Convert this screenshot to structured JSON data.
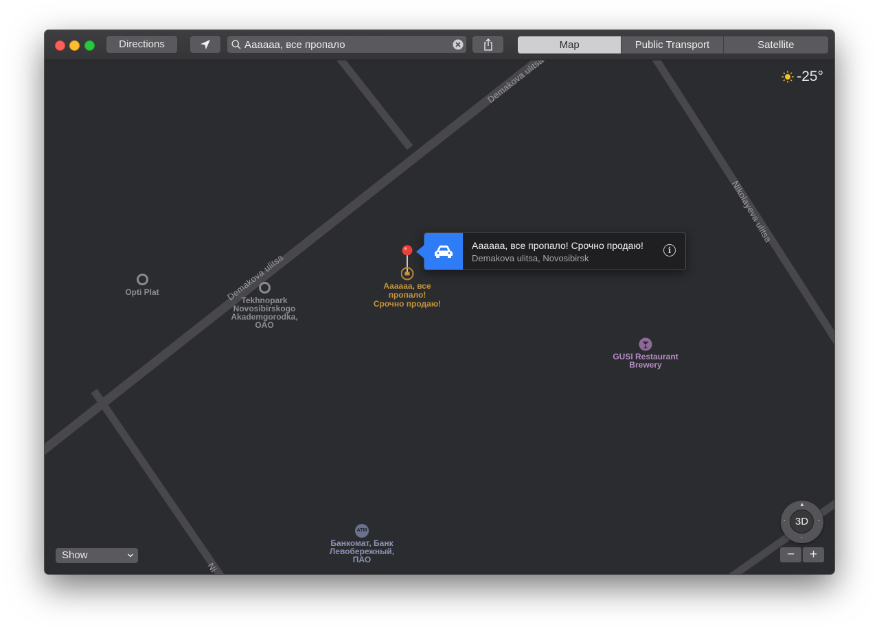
{
  "toolbar": {
    "directions_label": "Directions",
    "search_value": "Аааааа, все пропало",
    "map_types": [
      {
        "label": "Map",
        "active": true
      },
      {
        "label": "Public Transport",
        "active": false
      },
      {
        "label": "Satellite",
        "active": false
      }
    ],
    "icons": [
      "location-arrow-icon",
      "search-icon",
      "clear-search-icon",
      "share-icon"
    ]
  },
  "weather": {
    "temperature": "-25°",
    "icon": "sun-icon"
  },
  "map": {
    "roads": {
      "demakova_upper": "Demakova ulitsa",
      "demakova_lower": "Demakova ulitsa",
      "nikolayeva": "Nikolayeva ulitsa",
      "bottom_cut": "Ni"
    },
    "pois": {
      "opti_plat": "Opti Plat",
      "tekhnopark": [
        "Tekhnopark",
        "Novosibirskogo",
        "Akademgorodka,",
        "OAO"
      ],
      "gusi": [
        "GUSI Restaurant",
        "Brewery"
      ],
      "atm": [
        "Банкомат, Банк",
        "Левобережный,",
        "ПАО"
      ],
      "atm_icon_text": "ATM"
    },
    "pin_label": [
      "Аааааа, все",
      "пропало!",
      "Срочно продаю!"
    ]
  },
  "callout": {
    "title": "Аааааа, все пропало! Срочно продаю!",
    "subtitle": "Demakova ulitsa, Novosibirsk",
    "info_glyph": "i",
    "accent_color": "#2f7df6"
  },
  "controls": {
    "show_label": "Show",
    "compass_label": "3D",
    "zoom_out": "−",
    "zoom_in": "+"
  }
}
